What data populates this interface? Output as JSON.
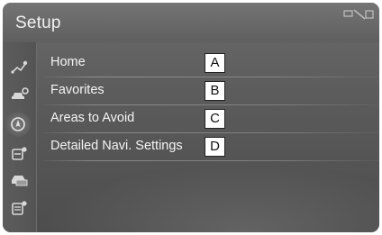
{
  "header": {
    "title": "Setup"
  },
  "sidebar": {
    "items": [
      {
        "icon": "route-icon"
      },
      {
        "icon": "car-settings-icon"
      },
      {
        "icon": "navigation-icon",
        "active": true
      },
      {
        "icon": "phone-settings-icon"
      },
      {
        "icon": "vehicle-icon"
      },
      {
        "icon": "data-settings-icon"
      }
    ]
  },
  "menu": {
    "items": [
      {
        "label": "Home",
        "callout": "A"
      },
      {
        "label": "Favorites",
        "callout": "B"
      },
      {
        "label": "Areas to Avoid",
        "callout": "C"
      },
      {
        "label": "Detailed Navi. Settings",
        "callout": "D"
      }
    ]
  }
}
